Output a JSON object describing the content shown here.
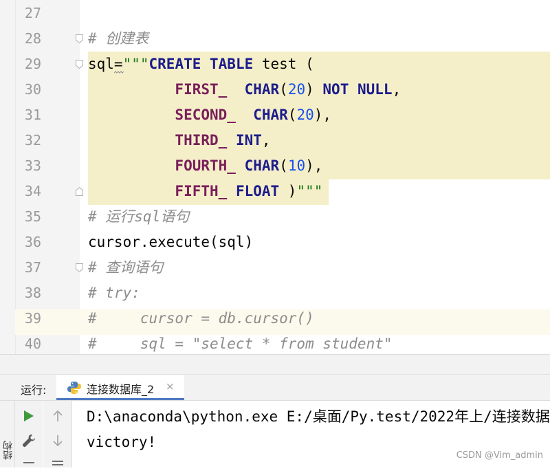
{
  "editor": {
    "lines": [
      {
        "num": "27",
        "segments": []
      },
      {
        "num": "28",
        "segments": [
          {
            "t": "# 创建表",
            "c": "cmt"
          }
        ]
      },
      {
        "num": "29",
        "segments": [
          {
            "t": "sql=",
            "c": "plain"
          },
          {
            "t": "\"\"\"",
            "c": "str"
          },
          {
            "t": "CREATE TABLE",
            "c": "kw"
          },
          {
            "t": " test (",
            "c": "plain"
          }
        ]
      },
      {
        "num": "30",
        "segments": [
          {
            "t": "          FIRST_",
            "c": "sqlid"
          },
          {
            "t": "  CHAR",
            "c": "kw"
          },
          {
            "t": "(",
            "c": "plain"
          },
          {
            "t": "20",
            "c": "num"
          },
          {
            "t": ") ",
            "c": "plain"
          },
          {
            "t": "NOT NULL",
            "c": "kw"
          },
          {
            "t": ",",
            "c": "plain"
          }
        ]
      },
      {
        "num": "31",
        "segments": [
          {
            "t": "          SECOND_",
            "c": "sqlid"
          },
          {
            "t": "  CHAR",
            "c": "kw"
          },
          {
            "t": "(",
            "c": "plain"
          },
          {
            "t": "20",
            "c": "num"
          },
          {
            "t": "),",
            "c": "plain"
          }
        ]
      },
      {
        "num": "32",
        "segments": [
          {
            "t": "          THIRD_",
            "c": "sqlid"
          },
          {
            "t": " INT",
            "c": "kw"
          },
          {
            "t": ",",
            "c": "plain"
          }
        ]
      },
      {
        "num": "33",
        "segments": [
          {
            "t": "          FOURTH_",
            "c": "sqlid"
          },
          {
            "t": " CHAR",
            "c": "kw"
          },
          {
            "t": "(",
            "c": "plain"
          },
          {
            "t": "10",
            "c": "num"
          },
          {
            "t": "),",
            "c": "plain"
          }
        ]
      },
      {
        "num": "34",
        "segments": [
          {
            "t": "          FIFTH_",
            "c": "sqlid"
          },
          {
            "t": " FLOAT",
            "c": "kw"
          },
          {
            "t": " )",
            "c": "plain"
          },
          {
            "t": "\"\"\"",
            "c": "str"
          }
        ]
      },
      {
        "num": "35",
        "segments": [
          {
            "t": "# 运行sql语句",
            "c": "cmt"
          }
        ]
      },
      {
        "num": "36",
        "segments": [
          {
            "t": "cursor.execute(sql)",
            "c": "plain"
          }
        ]
      },
      {
        "num": "37",
        "segments": [
          {
            "t": "# 查询语句",
            "c": "cmt"
          }
        ]
      },
      {
        "num": "38",
        "segments": [
          {
            "t": "# try:",
            "c": "cmt"
          }
        ]
      },
      {
        "num": "39",
        "segments": [
          {
            "t": "#     cursor = db.cursor()",
            "c": "cmt"
          }
        ]
      },
      {
        "num": "40",
        "segments": [
          {
            "t": "#     sql = \"select * from student\"",
            "c": "cmt"
          }
        ]
      }
    ]
  },
  "run_window": {
    "label": "运行:",
    "tab_label": "连接数据库_2",
    "tab_close": "×",
    "side_tab_label": "结构",
    "tools": {
      "run_icon": "play-icon",
      "wrench_icon": "wrench-icon",
      "up_icon": "arrow-up-icon",
      "down_icon": "arrow-down-icon",
      "menu_icon": "lines-icon"
    },
    "console_lines": [
      "D:\\anaconda\\python.exe E:/桌面/Py.test/2022年上/连接数据",
      "victory!"
    ]
  },
  "watermark": "CSDN @Vim_admin",
  "colors": {
    "highlight": "#f5efc9",
    "keyword": "#1c1c8c",
    "string": "#1b7a1b",
    "number": "#1750eb",
    "comment": "#8c8c8c",
    "run_green": "#3d9a3d",
    "tab_underline": "#4f7ac2"
  }
}
